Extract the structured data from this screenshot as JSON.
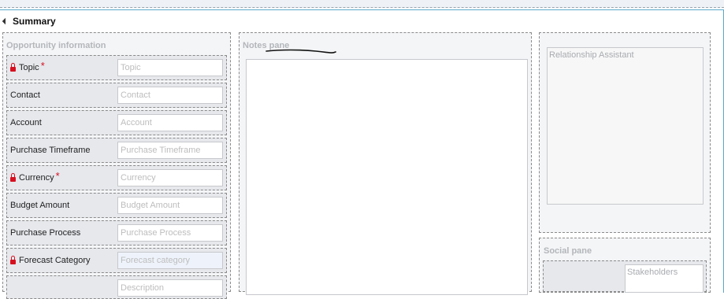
{
  "section": {
    "title": "Summary"
  },
  "opportunity": {
    "title": "Opportunity information",
    "fields": [
      {
        "label": "Topic",
        "placeholder": "Topic",
        "locked": true,
        "required": true
      },
      {
        "label": "Contact",
        "placeholder": "Contact",
        "locked": false,
        "required": false
      },
      {
        "label": "Account",
        "placeholder": "Account",
        "locked": false,
        "required": false
      },
      {
        "label": "Purchase Timeframe",
        "placeholder": "Purchase Timeframe",
        "locked": false,
        "required": false
      },
      {
        "label": "Currency",
        "placeholder": "Currency",
        "locked": true,
        "required": true
      },
      {
        "label": "Budget Amount",
        "placeholder": "Budget Amount",
        "locked": false,
        "required": false
      },
      {
        "label": "Purchase Process",
        "placeholder": "Purchase Process",
        "locked": false,
        "required": false
      },
      {
        "label": "Forecast Category",
        "placeholder": "Forecast category",
        "locked": true,
        "required": false
      },
      {
        "label": "",
        "placeholder": "Description",
        "locked": false,
        "required": false
      }
    ],
    "required_mark": "*"
  },
  "notes": {
    "title": "Notes pane"
  },
  "relationship": {
    "title": "Relationship Assistant"
  },
  "social": {
    "title": "Social pane",
    "stakeholders": "Stakeholders"
  },
  "colors": {
    "frame_accent": "#5aa8c8",
    "required": "#d6101f",
    "panel_bg": "#e6e8ec"
  }
}
